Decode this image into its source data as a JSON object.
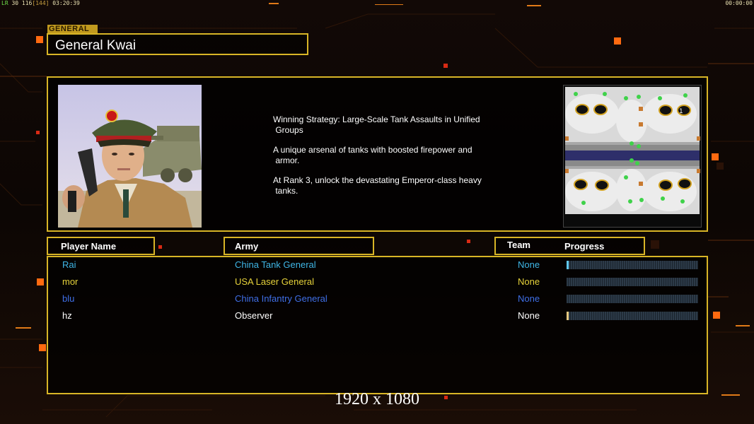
{
  "status_bar": {
    "left_lr": "LR",
    "left_fps": "30 116",
    "left_bracket": "[144]",
    "left_time": "03:20:39",
    "right_time": "00:00:00"
  },
  "general": {
    "tag": "GENERAL",
    "name": "General Kwai",
    "description": [
      "Winning Strategy: Large-Scale Tank Assaults in Unified\n Groups",
      "A unique arsenal of tanks with boosted firepower and\n armor.",
      "At Rank 3, unlock the devastating Emperor-class heavy\n tanks."
    ]
  },
  "headers": {
    "player_name": "Player Name",
    "army": "Army",
    "team": "Team",
    "progress": "Progress"
  },
  "players": [
    {
      "name": "Rai",
      "army": "China Tank General",
      "team": "None",
      "color": "#3fb6e6",
      "progress": 0.01,
      "bar_color": "#5fc8f0"
    },
    {
      "name": "mor",
      "army": "USA Laser General",
      "team": "None",
      "color": "#e6d23a",
      "progress": 0.0,
      "bar_color": "#e6d23a"
    },
    {
      "name": "blu",
      "army": "China Infantry General",
      "team": "None",
      "color": "#3f6fe6",
      "progress": 0.0,
      "bar_color": "#3f6fe6"
    },
    {
      "name": "hz",
      "army": "Observer",
      "team": "None",
      "color": "#ffffff",
      "progress": 0.01,
      "bar_color": "#e6c880"
    }
  ],
  "minimap": {
    "player_marker": "1"
  },
  "resolution_label": "1920 x 1080"
}
